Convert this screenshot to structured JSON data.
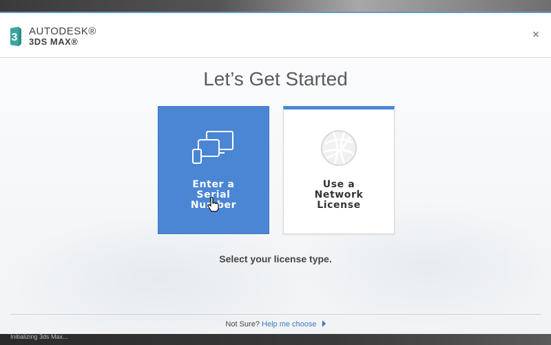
{
  "app": {
    "brand": "AUTODESK®",
    "product": "3DS MAX®",
    "logo_glyph": "3"
  },
  "header": {
    "close_label": "×"
  },
  "main": {
    "title": "Let’s Get Started",
    "options": [
      {
        "label": "Enter a Serial Number",
        "icon": "devices-icon"
      },
      {
        "label": "Use a Network License",
        "icon": "globe-network-icon"
      }
    ],
    "subtitle": "Select your license type."
  },
  "footer": {
    "prompt": "Not Sure?",
    "link": "Help me choose"
  },
  "background": {
    "status_text": "Initializing 3ds Max..."
  },
  "colors": {
    "accent": "#4a86d4",
    "link": "#3a78c3",
    "logo_teal": "#2f8f8c"
  }
}
